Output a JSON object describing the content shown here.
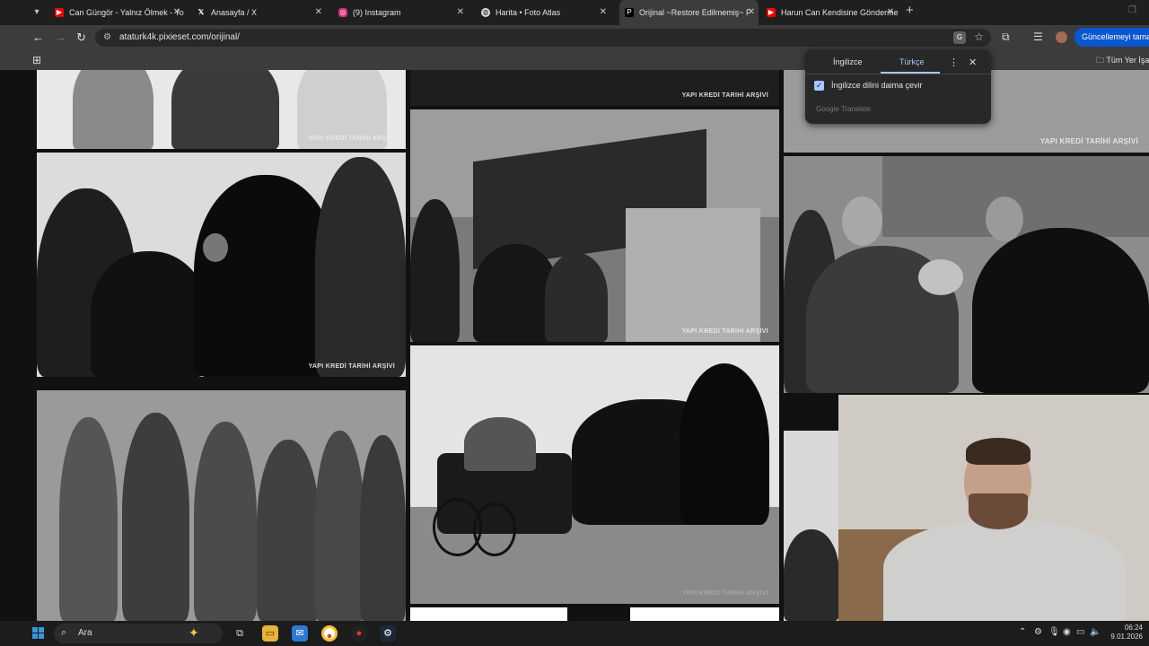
{
  "tabs": [
    {
      "title": "Can Güngör - Yalnız Ölmek - Yo",
      "icon": "youtube-icon",
      "active": false
    },
    {
      "title": "Anasayfa / X",
      "icon": "x-icon",
      "active": false
    },
    {
      "title": "(9) Instagram",
      "icon": "instagram-icon",
      "active": false
    },
    {
      "title": "Harita • Foto Atlas",
      "icon": "globe-icon",
      "active": false
    },
    {
      "title": "Orijinal ~Restore Edilmemiş~ F",
      "icon": "pixieset-icon",
      "active": true
    },
    {
      "title": "Harun Can Kendisine Gönderme",
      "icon": "youtube-icon",
      "active": false
    }
  ],
  "address_bar": {
    "url": "ataturk4k.pixieset.com/orijinal/"
  },
  "toolbar": {
    "update_label": "Güncellemeyi tamamla"
  },
  "bookmarks": {
    "all_bookmarks_label": "Tüm Yer İşar"
  },
  "translate_popup": {
    "tab_source": "İngilizce",
    "tab_target": "Türkçe",
    "checkbox_label": "İngilizce dilini daima çevir",
    "checkbox_checked": true,
    "footer": "Google Translate"
  },
  "gallery": {
    "watermark": "YAPI KREDİ TARİHİ ARŞİVİ",
    "watermark_faded": "YAPI KREDİ TARİHİ ARŞİVİ"
  },
  "taskbar": {
    "search_placeholder": "Ara",
    "time": "06:24",
    "date": "9.01.2026"
  },
  "colors": {
    "accent": "#0b57d0",
    "popup_accent": "#a8c7fa",
    "youtube": "#ff0000",
    "instagram": "#d62976"
  }
}
